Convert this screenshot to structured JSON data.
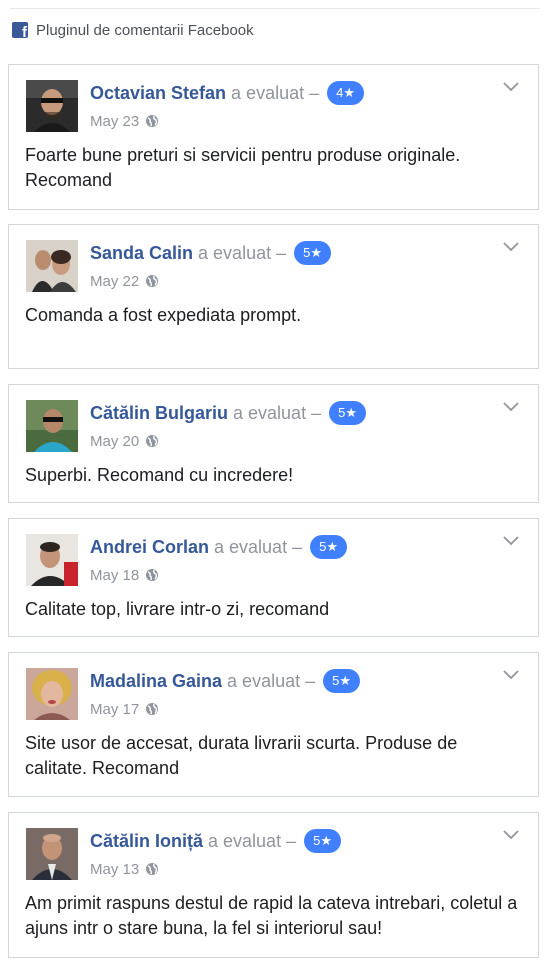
{
  "plugin": {
    "title": "Pluginul de comentarii Facebook",
    "icon": "facebook-icon",
    "brand_color": "#3b5998"
  },
  "accent_color": "#4080ff",
  "verb": "a evaluat –",
  "reviews": [
    {
      "name": "Octavian Stefan",
      "rating": "4★",
      "date": "May 23",
      "text": "Foarte bune preturi si servicii pentru produse originale. Recomand"
    },
    {
      "name": "Sanda Calin",
      "rating": "5★",
      "date": "May 22",
      "text": "Comanda a fost expediata prompt."
    },
    {
      "name": "Cătălin Bulgariu",
      "rating": "5★",
      "date": "May 20",
      "text": "Superbi. Recomand cu incredere!"
    },
    {
      "name": "Andrei Corlan",
      "rating": "5★",
      "date": "May 18",
      "text": "Calitate top, livrare intr-o zi, recomand"
    },
    {
      "name": "Madalina Gaina",
      "rating": "5★",
      "date": "May 17",
      "text": "Site usor de accesat, durata livrarii scurta. Produse de calitate. Recomand"
    },
    {
      "name": "Cătălin Ioniță",
      "rating": "5★",
      "date": "May 13",
      "text": "Am primit raspuns destul de rapid la cateva intrebari, coletul a ajuns intr o stare buna, la fel si interiorul sau!"
    }
  ]
}
